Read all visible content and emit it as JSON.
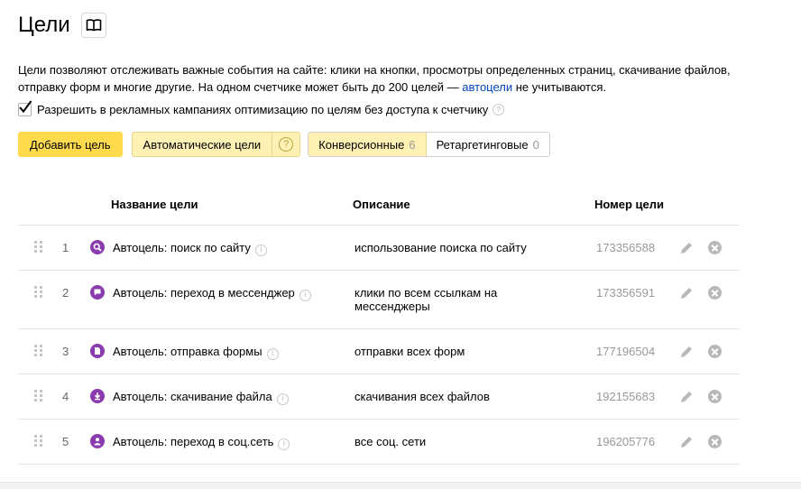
{
  "header": {
    "title": "Цели",
    "book_icon": "book-icon"
  },
  "description": {
    "line1": "Цели позволяют отслеживать важные события на сайте: клики на кнопки, просмотры определенных страниц, скачивание файлов,",
    "line2_before": "отправку форм и многие другие. На одном счетчике может быть до 200 целей — ",
    "link": "автоцели",
    "line2_after": " не учитываются."
  },
  "option": {
    "label": "Разрешить в рекламных кампаниях оптимизацию по целям без доступа к счетчику",
    "checked": true,
    "help": "?"
  },
  "toolbar": {
    "add_label": "Добавить цель",
    "auto_label": "Автоматические цели",
    "auto_help": "?",
    "tabs": [
      {
        "label": "Конверсионные",
        "count": "6"
      },
      {
        "label": "Ретаргетинговые",
        "count": "0"
      }
    ]
  },
  "table": {
    "headers": {
      "name": "Название цели",
      "description": "Описание",
      "id": "Номер цели"
    },
    "rows": [
      {
        "num": "1",
        "icon": "search-icon",
        "name": "Автоцель: поиск по сайту",
        "description": "использование поиска по сайту",
        "id": "173356588"
      },
      {
        "num": "2",
        "icon": "chat-icon",
        "name": "Автоцель: переход в мессенджер",
        "description": "клики по всем ссылкам на мессенджеры",
        "id": "173356591"
      },
      {
        "num": "3",
        "icon": "document-icon",
        "name": "Автоцель: отправка формы",
        "description": "отправки всех форм",
        "id": "177196504"
      },
      {
        "num": "4",
        "icon": "download-icon",
        "name": "Автоцель: скачивание файла",
        "description": "скачивания всех файлов",
        "id": "192155683"
      },
      {
        "num": "5",
        "icon": "user-icon",
        "name": "Автоцель: переход в соц.сеть",
        "description": "все соц. сети",
        "id": "196205776"
      }
    ]
  },
  "colors": {
    "accent_yellow": "#ffdb4d",
    "light_yellow": "#fff0b3",
    "goal_icon_purple": "#8a3bb0",
    "link_blue": "#0044bb"
  }
}
